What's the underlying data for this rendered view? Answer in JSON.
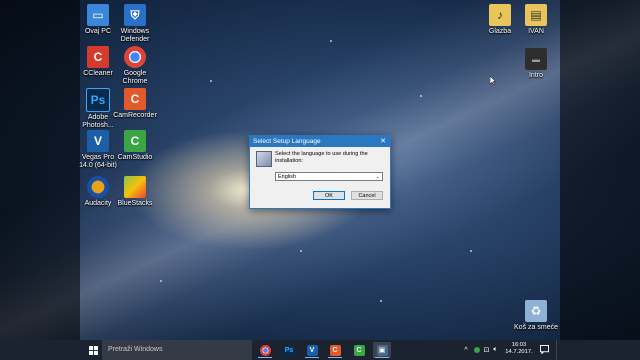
{
  "desktop": {
    "icons": [
      {
        "label": "Ovaj PC",
        "icon": "pc-icon",
        "color": "#3a86d8"
      },
      {
        "label": "Windows\nDefender",
        "icon": "defender-icon",
        "color": "#2a6fc9"
      },
      {
        "label": "CCleaner",
        "icon": "ccleaner-icon",
        "color": "#d53b2c"
      },
      {
        "label": "Google\nChrome",
        "icon": "chrome-icon",
        "color": "#db4437"
      },
      {
        "label": "Adobe\nPhotosh...",
        "icon": "photoshop-icon",
        "color": "#0b2a4a"
      },
      {
        "label": "CamRecorder",
        "icon": "camrecorder-icon",
        "color": "#e25a2c"
      },
      {
        "label": "Vegas Pro\n14.0 (64-bit)",
        "icon": "vegas-icon",
        "color": "#1c5fa8"
      },
      {
        "label": "CamStudio",
        "icon": "camstudio-icon",
        "color": "#3aa544"
      },
      {
        "label": "Audacity",
        "icon": "audacity-icon",
        "color": "#e4a31a"
      },
      {
        "label": "BlueStacks",
        "icon": "bluestacks-icon",
        "color": "#8bc34a"
      },
      {
        "label": "Glazba",
        "icon": "music-folder-icon",
        "color": "#e8c45a"
      },
      {
        "label": "IVAN",
        "icon": "user-folder-icon",
        "color": "#e8c45a"
      },
      {
        "label": "Intro",
        "icon": "video-file-icon",
        "color": "#2e2e2e"
      },
      {
        "label": "Koš za smeće",
        "icon": "recycle-bin-icon",
        "color": "#8fb1d6"
      }
    ]
  },
  "dialog": {
    "title": "Select Setup Language",
    "close": "✕",
    "message": "Select the language to use during the installation:",
    "selected_language": "English",
    "ok_label": "OK",
    "cancel_label": "Cancel"
  },
  "taskbar": {
    "search_placeholder": "Pretraži Windows",
    "apps": [
      {
        "icon": "chrome-icon",
        "color": "#db4437",
        "glyph": "●"
      },
      {
        "icon": "photoshop-icon",
        "color": "#0b2a4a",
        "glyph": "Ps"
      },
      {
        "icon": "vegas-icon",
        "color": "#1c5fa8",
        "glyph": "V"
      },
      {
        "icon": "camrecorder-icon",
        "color": "#e25a2c",
        "glyph": "C"
      },
      {
        "icon": "camstudio-icon",
        "color": "#3aa544",
        "glyph": "C"
      },
      {
        "icon": "installer-icon",
        "color": "#4a6a8a",
        "glyph": "▣"
      }
    ],
    "tray": {
      "time": "16:03",
      "date": "14.7.2017."
    }
  }
}
